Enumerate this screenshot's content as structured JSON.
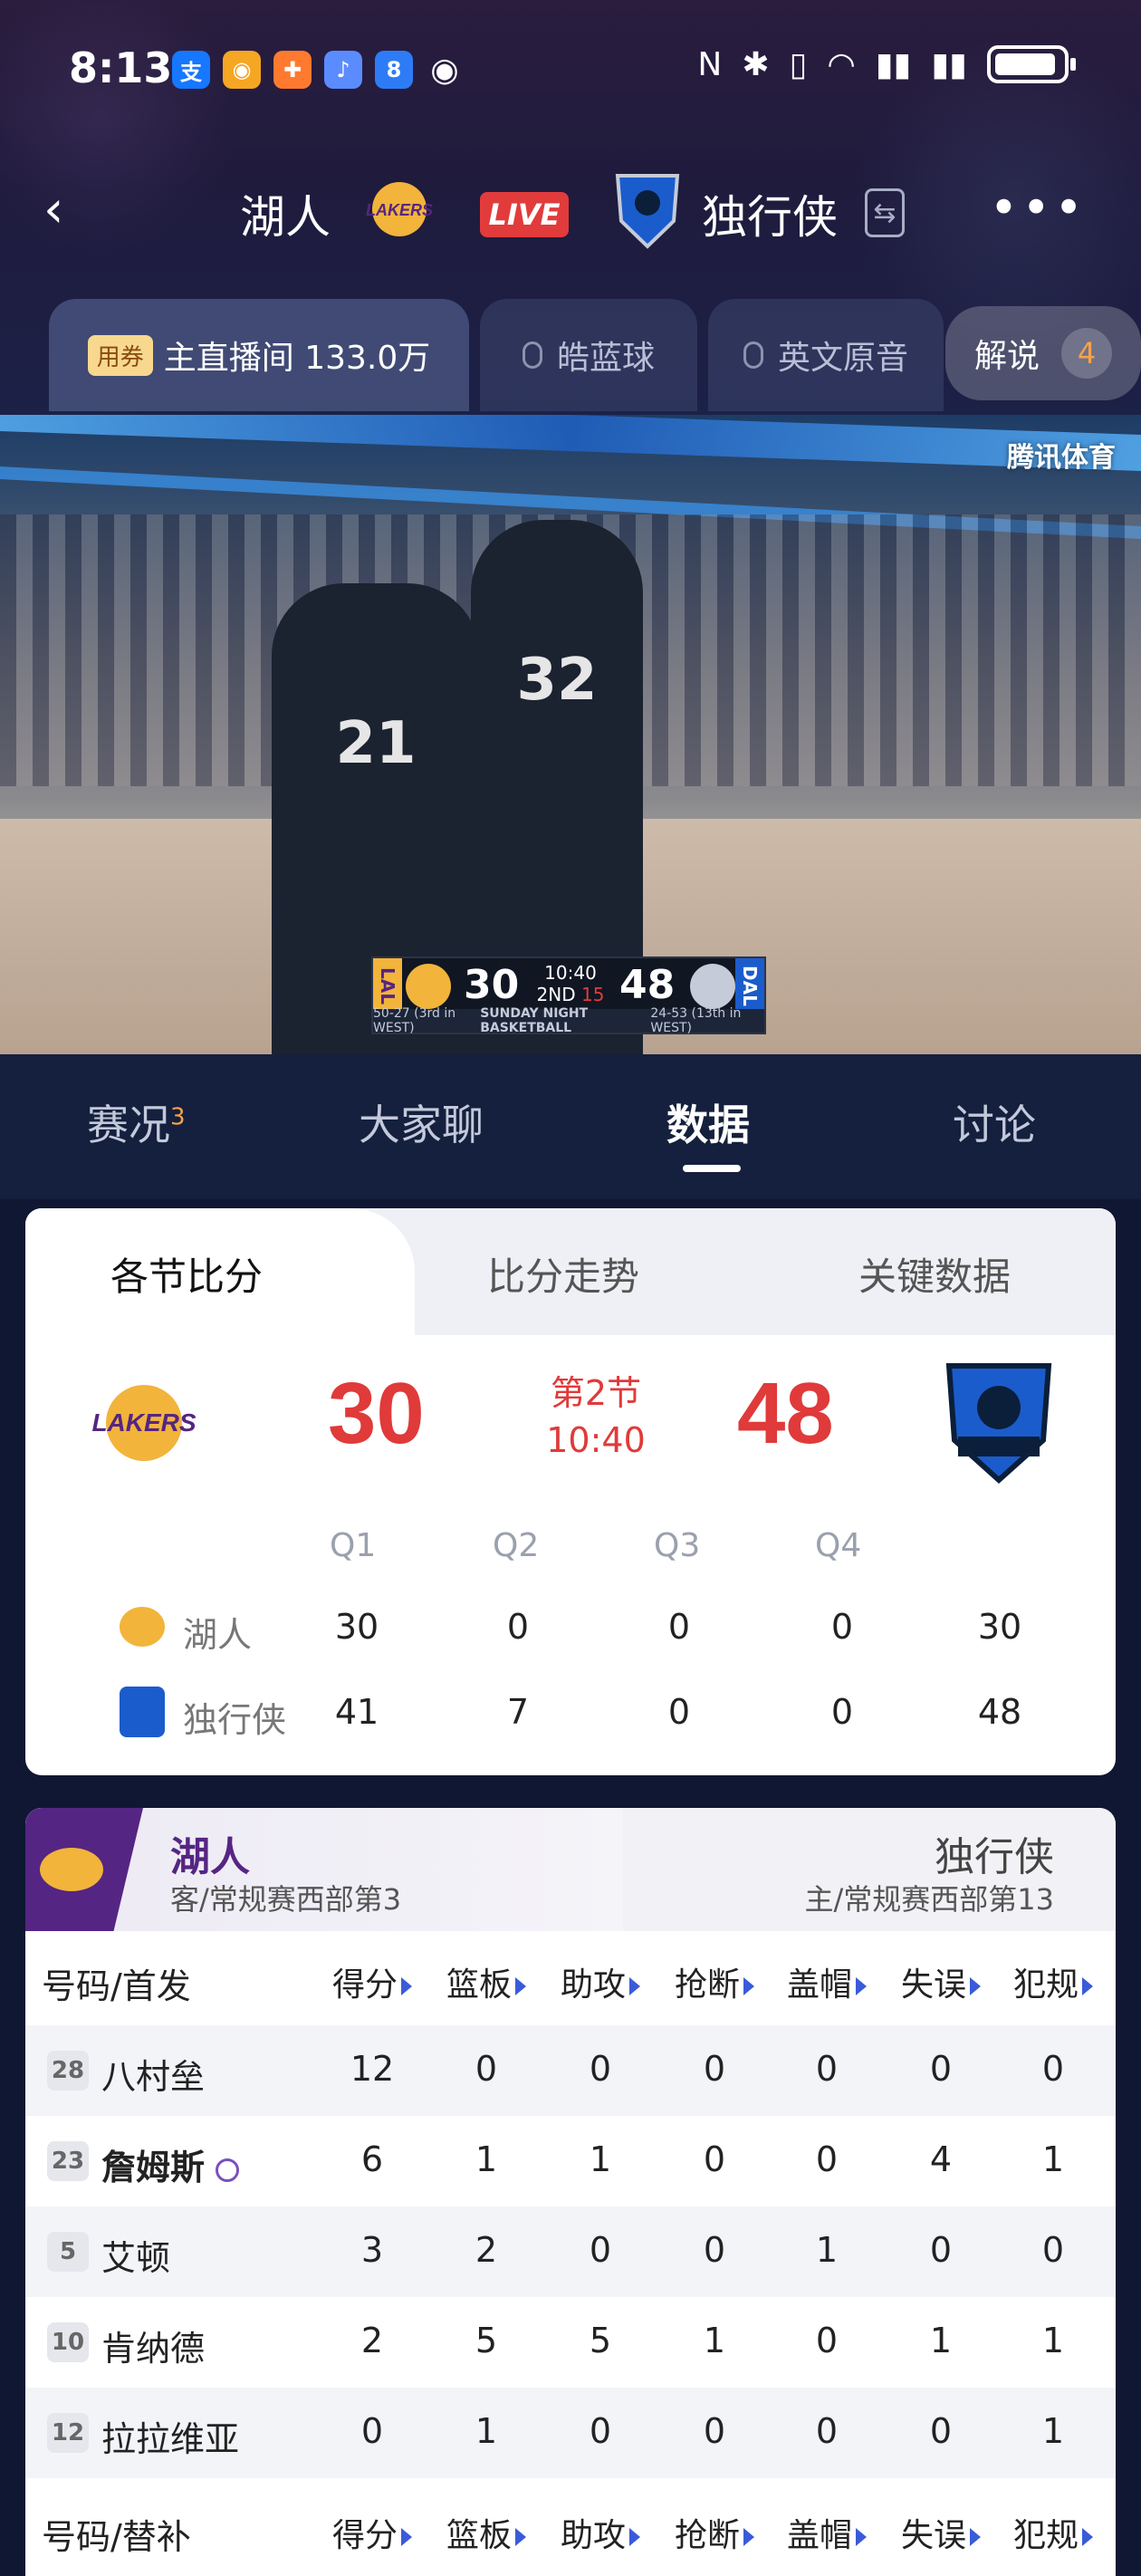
{
  "status_bar": {
    "time": "8:13",
    "app_icons": [
      "alipay-icon",
      "weibo-icon",
      "app-icon",
      "music-icon",
      "app8-icon",
      "eye-icon"
    ],
    "system_icons": [
      "nfc-icon",
      "bluetooth-icon",
      "vibrate-icon",
      "wifi-icon",
      "signal-icon",
      "signal-icon",
      "battery-icon"
    ]
  },
  "header": {
    "home_team": "湖人",
    "away_team": "独行侠",
    "live_label": "LIVE"
  },
  "channels": [
    {
      "coupon": "用券",
      "label": "主直播间 133.0万"
    },
    {
      "label": "皓蓝球"
    },
    {
      "label": "英文原音"
    },
    {
      "label": "解说",
      "count": "4"
    }
  ],
  "video": {
    "broadcaster": "腾讯体育",
    "scorebug": {
      "home_abbr": "LAL",
      "away_abbr": "DAL",
      "home_score": "30",
      "away_score": "48",
      "clock": "10:40",
      "period": "2ND",
      "shot_clock": "15",
      "home_record": "50-27 (3rd in WEST)",
      "title": "SUNDAY NIGHT BASKETBALL",
      "away_record": "24-53 (13th in WEST)"
    },
    "players": [
      "21",
      "32"
    ]
  },
  "main_tabs": [
    {
      "label": "赛况",
      "badge": "3"
    },
    {
      "label": "大家聊"
    },
    {
      "label": "数据"
    },
    {
      "label": "讨论"
    }
  ],
  "score_card": {
    "subtabs": [
      "各节比分",
      "比分走势",
      "关键数据"
    ],
    "home_score": "30",
    "away_score": "48",
    "period": "第2节",
    "clock": "10:40",
    "quarter_headers": [
      "Q1",
      "Q2",
      "Q3",
      "Q4"
    ],
    "rows": [
      {
        "team": "湖人",
        "q": [
          "30",
          "0",
          "0",
          "0"
        ],
        "total": "30"
      },
      {
        "team": "独行侠",
        "q": [
          "41",
          "7",
          "0",
          "0"
        ],
        "total": "48"
      }
    ]
  },
  "player_card": {
    "home_name": "湖人",
    "home_sub": "客/常规赛西部第3",
    "away_name": "独行侠",
    "away_sub": "主/常规赛西部第13",
    "starters_label": "号码/首发",
    "bench_label": "号码/替补",
    "columns": [
      "得分",
      "篮板",
      "助攻",
      "抢断",
      "盖帽",
      "失误",
      "犯规"
    ],
    "starters": [
      {
        "num": "28",
        "name": "八村垒",
        "stats": [
          "12",
          "0",
          "0",
          "0",
          "0",
          "0",
          "0"
        ]
      },
      {
        "num": "23",
        "name": "詹姆斯",
        "stats": [
          "6",
          "1",
          "1",
          "0",
          "0",
          "4",
          "1"
        ]
      },
      {
        "num": "5",
        "name": "艾顿",
        "stats": [
          "3",
          "2",
          "0",
          "0",
          "1",
          "0",
          "0"
        ]
      },
      {
        "num": "10",
        "name": "肯纳德",
        "stats": [
          "2",
          "5",
          "5",
          "1",
          "0",
          "1",
          "1"
        ]
      },
      {
        "num": "12",
        "name": "拉拉维亚",
        "stats": [
          "0",
          "1",
          "0",
          "0",
          "0",
          "0",
          "1"
        ]
      }
    ]
  },
  "colors": {
    "accent_red": "#e03a3a",
    "lakers_purple": "#552583",
    "lakers_gold": "#f2b43a",
    "mavs_blue": "#1b5ccc",
    "live_red": "#e23b3b"
  }
}
